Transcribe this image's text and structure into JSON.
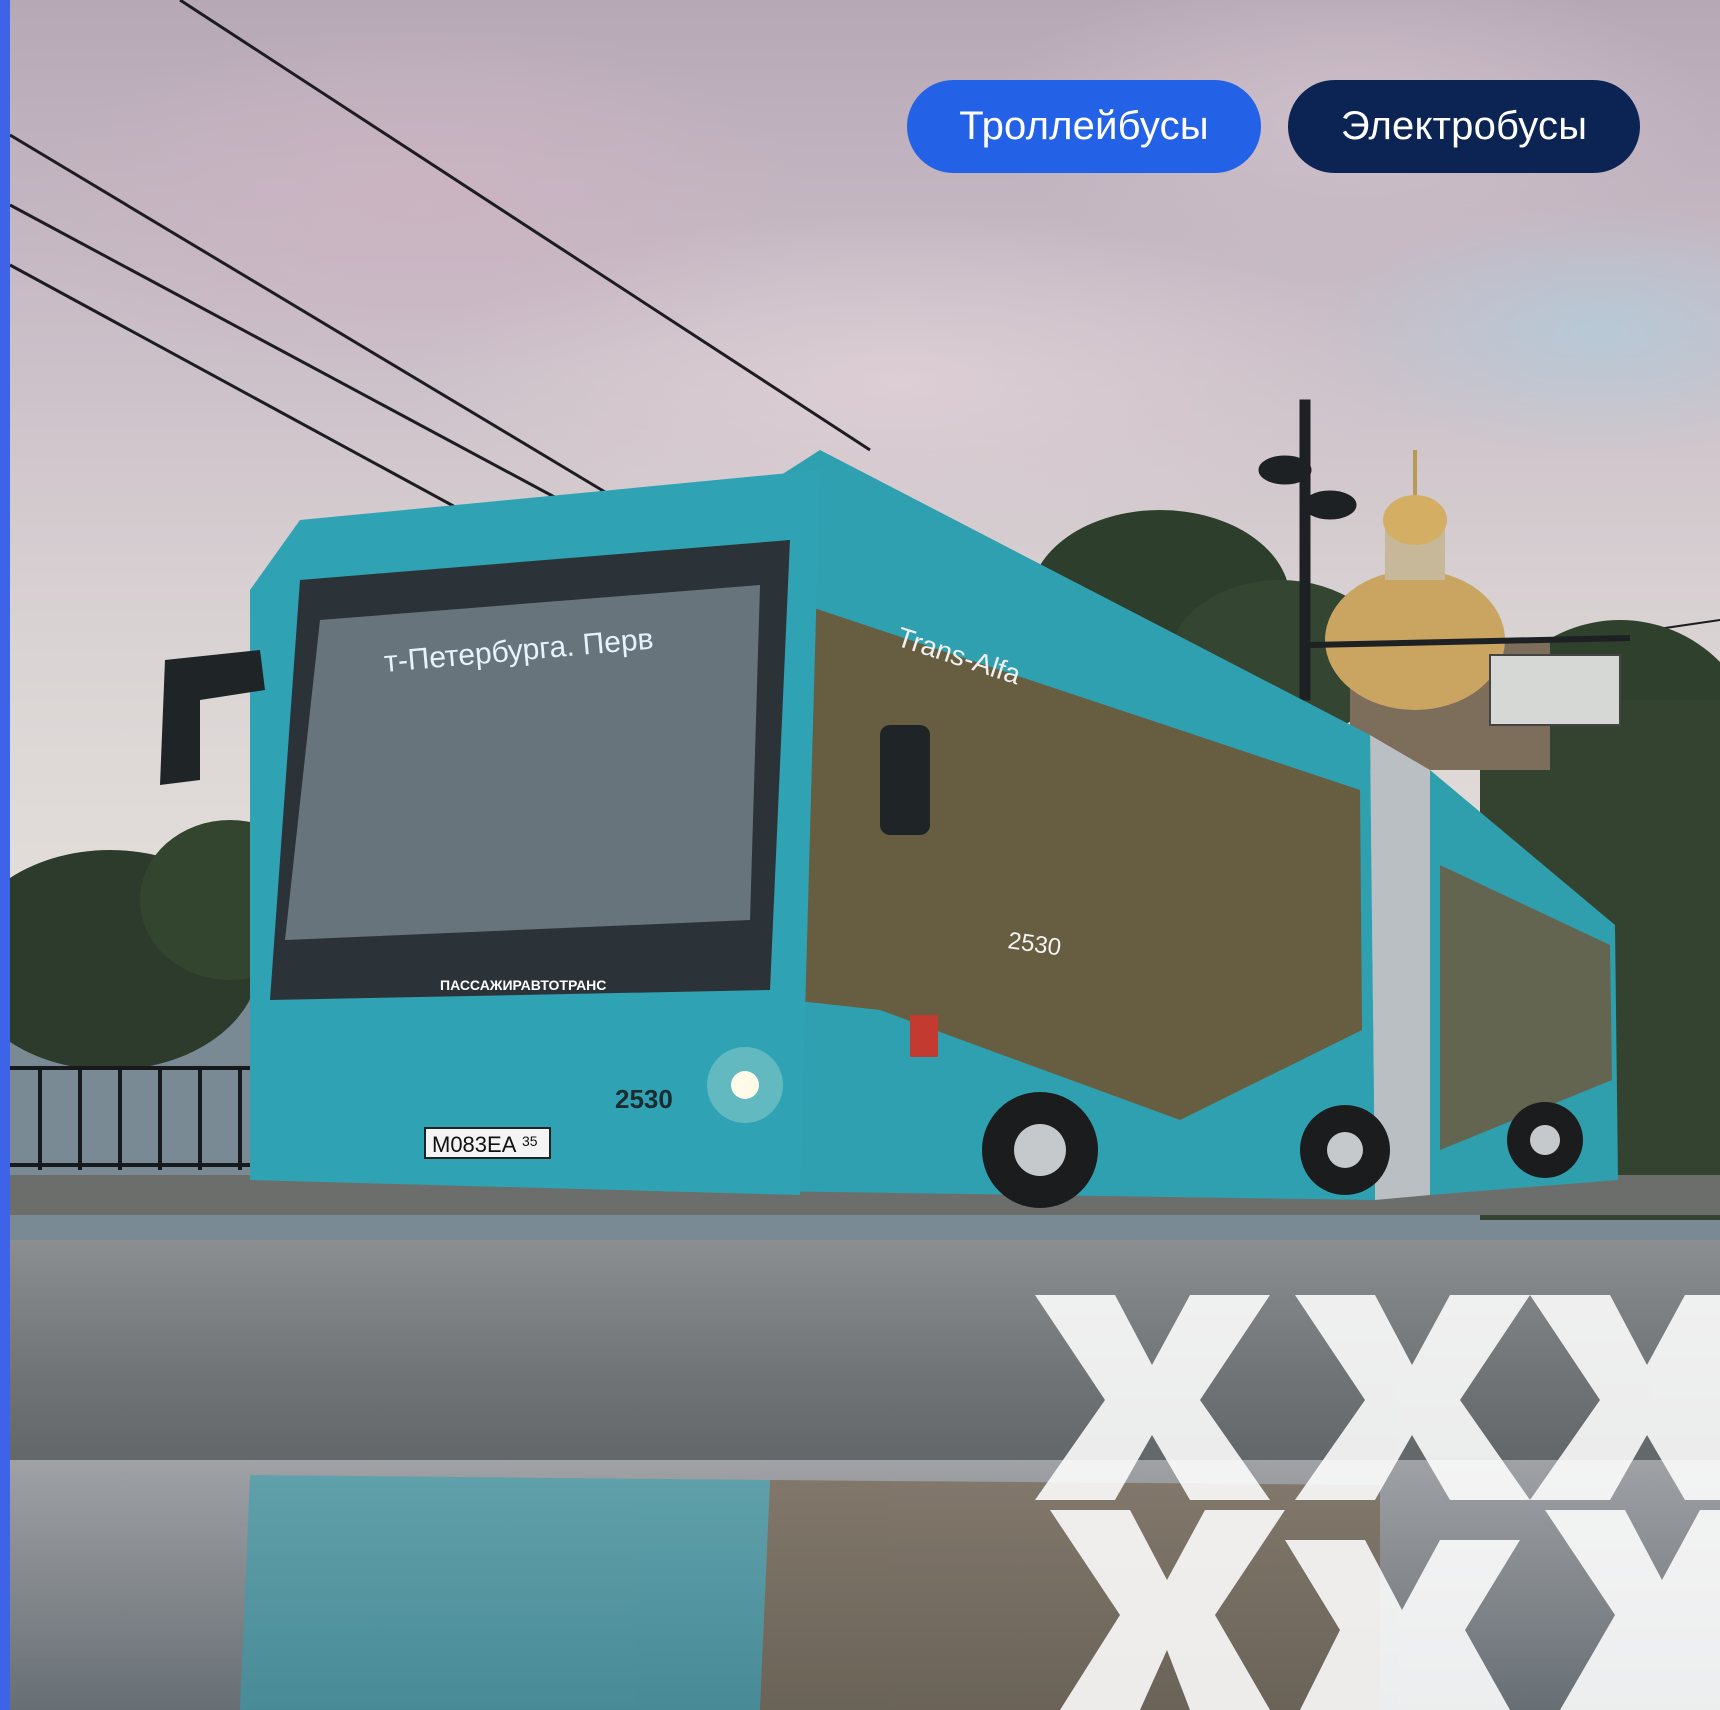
{
  "tabs": [
    {
      "label": "Троллейбусы",
      "color": "#2361e6",
      "active": true
    },
    {
      "label": "Электробусы",
      "color": "#0c2453",
      "active": false
    }
  ],
  "photo": {
    "bus_destination_sign": "т-Петербурга. Перв",
    "bus_side_text": "Trans-Alfa",
    "bus_number": "2530",
    "bus_operator_logo": "ПАССАЖИРАВТОТРАНС",
    "license_plate": "М083ЕА",
    "license_plate_region": "35",
    "bus_color": "#2f9fae",
    "accent_strip_color": "#3d63e8",
    "decor_pattern_color": "#ffffff"
  }
}
